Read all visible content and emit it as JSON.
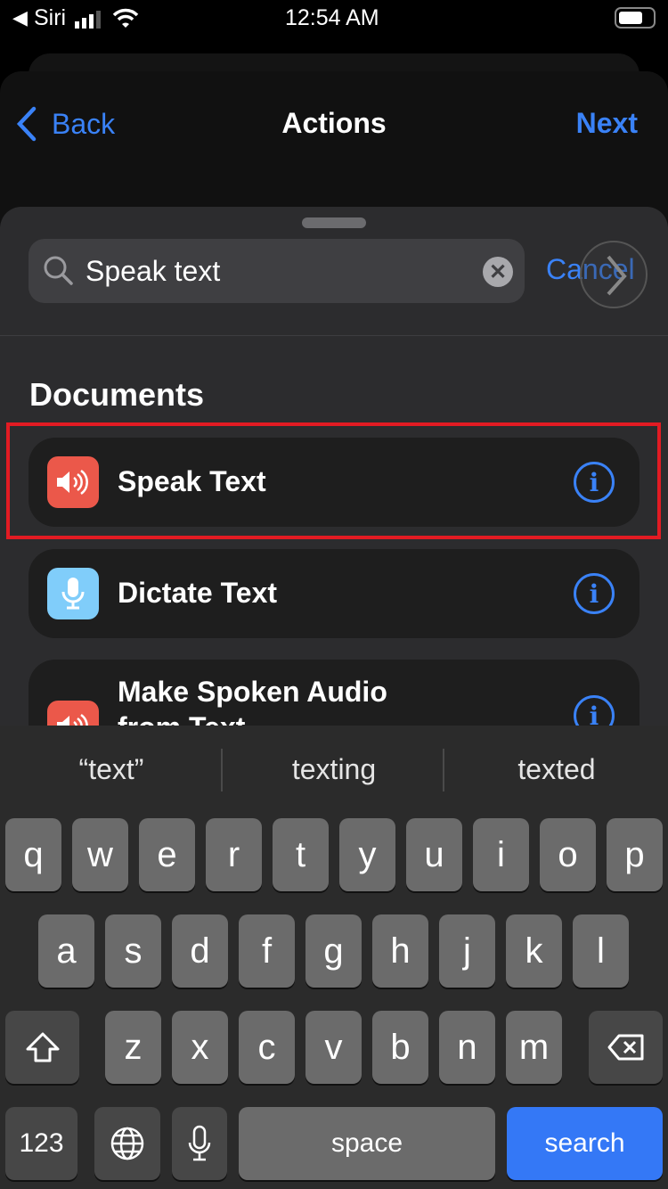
{
  "status_bar": {
    "back_app": "Siri",
    "time": "12:54 AM"
  },
  "nav": {
    "back_label": "Back",
    "title": "Actions",
    "next_label": "Next"
  },
  "search": {
    "value": "Speak text",
    "cancel_label": "Cancel"
  },
  "section_title": "Documents",
  "actions": [
    {
      "label": "Speak Text",
      "icon": "speaker-icon",
      "color": "#eb584a"
    },
    {
      "label": "Dictate Text",
      "icon": "microphone-icon",
      "color": "#80cdfa"
    },
    {
      "label": "Make Spoken Audio from Text",
      "icon": "speaker-icon",
      "color": "#eb584a"
    }
  ],
  "keyboard": {
    "suggestions": [
      "“text”",
      "texting",
      "texted"
    ],
    "row1": [
      "q",
      "w",
      "e",
      "r",
      "t",
      "y",
      "u",
      "i",
      "o",
      "p"
    ],
    "row2": [
      "a",
      "s",
      "d",
      "f",
      "g",
      "h",
      "j",
      "k",
      "l"
    ],
    "row3": [
      "z",
      "x",
      "c",
      "v",
      "b",
      "n",
      "m"
    ],
    "numbers_label": "123",
    "space_label": "space",
    "search_label": "search"
  },
  "colors": {
    "accent": "#3a82f7",
    "highlight": "#e21b23",
    "search_key": "#3478f6"
  }
}
